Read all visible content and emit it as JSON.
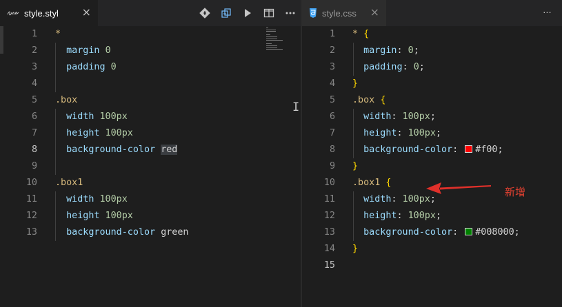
{
  "left_editor": {
    "tab": {
      "title": "style.styl",
      "close": "×"
    },
    "active_line": "8",
    "lines": [
      {
        "n": "1",
        "tokens": [
          {
            "c": "sel",
            "t": "*"
          }
        ]
      },
      {
        "n": "2",
        "tokens": [
          {
            "c": "prop",
            "t": "  margin "
          },
          {
            "c": "num",
            "t": "0"
          }
        ]
      },
      {
        "n": "3",
        "tokens": [
          {
            "c": "prop",
            "t": "  padding "
          },
          {
            "c": "num",
            "t": "0"
          }
        ]
      },
      {
        "n": "4",
        "tokens": []
      },
      {
        "n": "5",
        "tokens": [
          {
            "c": "sel",
            "t": ".box"
          }
        ]
      },
      {
        "n": "6",
        "tokens": [
          {
            "c": "prop",
            "t": "  width "
          },
          {
            "c": "num",
            "t": "100px"
          }
        ]
      },
      {
        "n": "7",
        "tokens": [
          {
            "c": "prop",
            "t": "  height "
          },
          {
            "c": "num",
            "t": "100px"
          }
        ]
      },
      {
        "n": "8",
        "tokens": [
          {
            "c": "prop",
            "t": "  background-color "
          },
          {
            "c": "plain hl",
            "t": "red"
          }
        ]
      },
      {
        "n": "9",
        "tokens": []
      },
      {
        "n": "10",
        "tokens": [
          {
            "c": "sel",
            "t": ".box1"
          }
        ]
      },
      {
        "n": "11",
        "tokens": [
          {
            "c": "prop",
            "t": "  width "
          },
          {
            "c": "num",
            "t": "100px"
          }
        ]
      },
      {
        "n": "12",
        "tokens": [
          {
            "c": "prop",
            "t": "  height "
          },
          {
            "c": "num",
            "t": "100px"
          }
        ]
      },
      {
        "n": "13",
        "tokens": [
          {
            "c": "prop",
            "t": "  background-color "
          },
          {
            "c": "plain",
            "t": "green"
          }
        ]
      }
    ]
  },
  "right_editor": {
    "tab": {
      "title": "style.css",
      "close": "×",
      "more": "···"
    },
    "active_line": "15",
    "lines": [
      {
        "n": "1",
        "tokens": [
          {
            "c": "sel",
            "t": "* "
          },
          {
            "c": "brace",
            "t": "{"
          }
        ]
      },
      {
        "n": "2",
        "tokens": [
          {
            "c": "prop",
            "t": "  margin"
          },
          {
            "c": "plain",
            "t": ": "
          },
          {
            "c": "num",
            "t": "0"
          },
          {
            "c": "plain",
            "t": ";"
          }
        ]
      },
      {
        "n": "3",
        "tokens": [
          {
            "c": "prop",
            "t": "  padding"
          },
          {
            "c": "plain",
            "t": ": "
          },
          {
            "c": "num",
            "t": "0"
          },
          {
            "c": "plain",
            "t": ";"
          }
        ]
      },
      {
        "n": "4",
        "tokens": [
          {
            "c": "brace",
            "t": "}"
          }
        ]
      },
      {
        "n": "5",
        "tokens": [
          {
            "c": "sel",
            "t": ".box "
          },
          {
            "c": "brace",
            "t": "{"
          }
        ]
      },
      {
        "n": "6",
        "tokens": [
          {
            "c": "prop",
            "t": "  width"
          },
          {
            "c": "plain",
            "t": ": "
          },
          {
            "c": "num",
            "t": "100px"
          },
          {
            "c": "plain",
            "t": ";"
          }
        ]
      },
      {
        "n": "7",
        "tokens": [
          {
            "c": "prop",
            "t": "  height"
          },
          {
            "c": "plain",
            "t": ": "
          },
          {
            "c": "num",
            "t": "100px"
          },
          {
            "c": "plain",
            "t": ";"
          }
        ]
      },
      {
        "n": "8",
        "tokens": [
          {
            "c": "prop",
            "t": "  background-color"
          },
          {
            "c": "plain",
            "t": ": "
          },
          {
            "c": "swatch",
            "t": "#ff0000"
          },
          {
            "c": "plain",
            "t": "#f00;"
          }
        ]
      },
      {
        "n": "9",
        "tokens": [
          {
            "c": "brace",
            "t": "}"
          }
        ]
      },
      {
        "n": "10",
        "tokens": [
          {
            "c": "sel",
            "t": ".box1 "
          },
          {
            "c": "brace",
            "t": "{"
          }
        ]
      },
      {
        "n": "11",
        "tokens": [
          {
            "c": "prop",
            "t": "  width"
          },
          {
            "c": "plain",
            "t": ": "
          },
          {
            "c": "num",
            "t": "100px"
          },
          {
            "c": "plain",
            "t": ";"
          }
        ]
      },
      {
        "n": "12",
        "tokens": [
          {
            "c": "prop",
            "t": "  height"
          },
          {
            "c": "plain",
            "t": ": "
          },
          {
            "c": "num",
            "t": "100px"
          },
          {
            "c": "plain",
            "t": ";"
          }
        ]
      },
      {
        "n": "13",
        "tokens": [
          {
            "c": "prop",
            "t": "  background-color"
          },
          {
            "c": "plain",
            "t": ": "
          },
          {
            "c": "swatch",
            "t": "#008000"
          },
          {
            "c": "plain",
            "t": "#008000;"
          }
        ]
      },
      {
        "n": "14",
        "tokens": [
          {
            "c": "brace",
            "t": "}"
          }
        ]
      },
      {
        "n": "15",
        "tokens": []
      }
    ]
  },
  "toolbar_icons": [
    "git-compare-icon",
    "open-changes-icon",
    "run-icon",
    "split-editor-icon",
    "more-actions-icon"
  ],
  "annotation": {
    "text": "新增",
    "color": "#e04030"
  },
  "colors": {
    "selector": "#d7ba7d",
    "property": "#9cdcfe",
    "number": "#b5cea8",
    "brace": "#ffd700",
    "text": "#d4d4d4",
    "background": "#1e1e1e"
  }
}
